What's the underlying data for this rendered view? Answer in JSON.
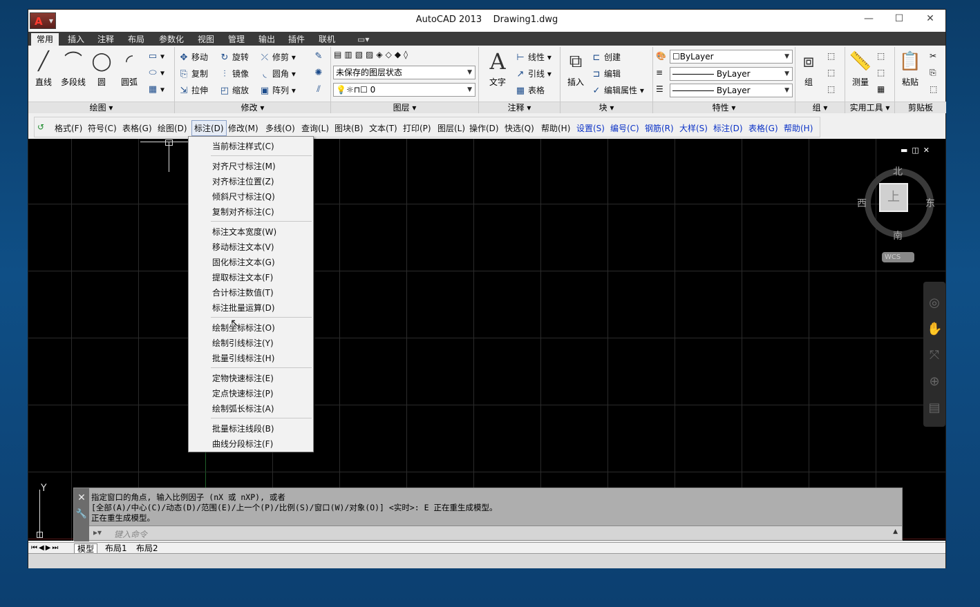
{
  "window": {
    "title": "AutoCAD 2013",
    "filename": "Drawing1.dwg",
    "minimize": "—",
    "maximize": "☐",
    "close": "✕"
  },
  "tabs": [
    "常用",
    "插入",
    "注释",
    "布局",
    "参数化",
    "视图",
    "管理",
    "输出",
    "插件",
    "联机"
  ],
  "ribbon": {
    "draw": {
      "line": "直线",
      "polyline": "多段线",
      "circle": "圆",
      "arc": "圆弧",
      "title": "绘图 ▾"
    },
    "modify": {
      "move": "移动",
      "rotate": "旋转",
      "trim": "修剪",
      "copy": "复制",
      "mirror": "镜像",
      "fillet": "圆角",
      "stretch": "拉伸",
      "scale": "缩放",
      "array": "阵列",
      "title": "修改 ▾"
    },
    "layers": {
      "state": "未保存的图层状态",
      "current": "0",
      "title": "图层 ▾"
    },
    "annotation": {
      "text": "文字",
      "linear": "线性",
      "leader": "引线",
      "table": "表格",
      "title": "注释 ▾"
    },
    "block": {
      "insert": "插入",
      "create": "创建",
      "edit": "编辑",
      "edit_attr": "编辑属性",
      "title": "块 ▾"
    },
    "properties": {
      "color": "ByLayer",
      "linetype": "ByLayer",
      "lineweight": "ByLayer",
      "title": "特性 ▾"
    },
    "groups": {
      "group": "组",
      "title": "组 ▾"
    },
    "utilities": {
      "measure": "测量",
      "title": "实用工具 ▾"
    },
    "clipboard": {
      "paste": "粘贴",
      "title": "剪贴板"
    }
  },
  "menubar": [
    "格式(F)",
    "符号(C)",
    "表格(G)",
    "绘图(D)",
    "标注(D)",
    "修改(M)",
    "多线(O)",
    "查询(L)",
    "图块(B)",
    "文本(T)",
    "打印(P)",
    "图层(L)",
    "操作(D)",
    "快选(Q)",
    "帮助(H)"
  ],
  "menubar_blue": [
    "设置(S)",
    "编号(C)",
    "钢筋(R)",
    "大样(S)",
    "标注(D)",
    "表格(G)",
    "帮助(H)"
  ],
  "dropdown": {
    "g1": [
      "当前标注样式(C)"
    ],
    "g2": [
      "对齐尺寸标注(M)",
      "对齐标注位置(Z)",
      "倾斜尺寸标注(Q)",
      "复制对齐标注(C)"
    ],
    "g3": [
      "标注文本宽度(W)",
      "移动标注文本(V)",
      "固化标注文本(G)",
      "提取标注文本(F)",
      "合计标注数值(T)",
      "标注批量运算(D)"
    ],
    "g4": [
      "绘制坐标标注(O)",
      "绘制引线标注(Y)",
      "批量引线标注(H)"
    ],
    "g5": [
      "定物快速标注(E)",
      "定点快速标注(P)",
      "绘制弧长标注(A)"
    ],
    "g6": [
      "批量标注线段(B)",
      "曲线分段标注(F)"
    ]
  },
  "compass": {
    "n": "北",
    "s": "南",
    "e": "东",
    "w": "西",
    "top": "上",
    "wcs": "WCS"
  },
  "command": {
    "line1": "指定窗口的角点, 输入比例因子 (nX 或 nXP), 或者",
    "line2": "[全部(A)/中心(C)/动态(D)/范围(E)/上一个(P)/比例(S)/窗口(W)/对象(O)] <实时>: E 正在重生成模型。",
    "line3": "正在重生成模型。",
    "placeholder": "键入命令"
  },
  "layout_tabs": [
    "模型",
    "布局1",
    "布局2"
  ],
  "ucs": {
    "y": "Y"
  },
  "colors": {
    "menu_blue": "#0b32c6",
    "canvas": "#000000",
    "tabbar": "#3a3a3a"
  }
}
